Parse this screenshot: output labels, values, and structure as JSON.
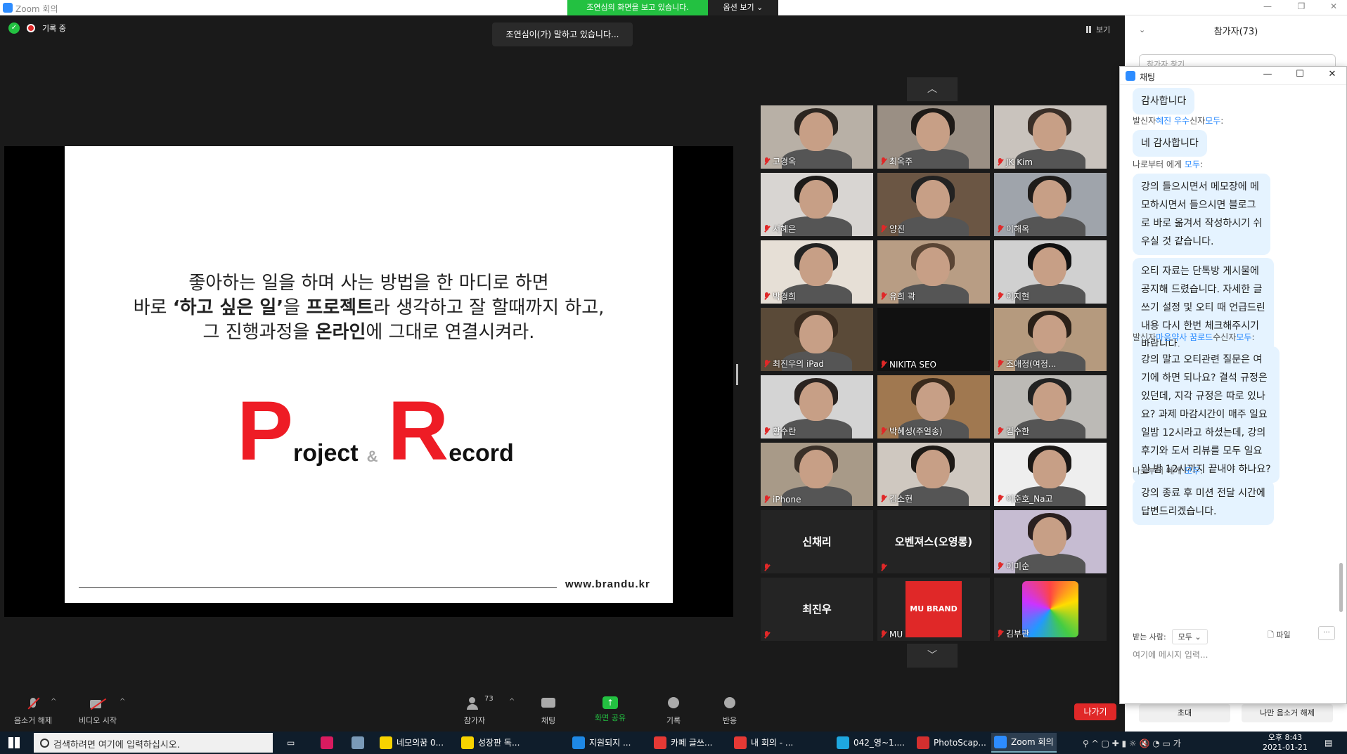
{
  "window": {
    "title": "Zoom 회의"
  },
  "banner": {
    "viewing": "조연심의 화면을 보고 있습니다.",
    "options": "옵션 보기 ⌄"
  },
  "status": {
    "recording": "기록 중",
    "speaking": "조연심이(가) 말하고 있습니다...",
    "view": "보기"
  },
  "slide": {
    "line1": "좋아하는 일을 하며 사는 방법을 한 마디로 하면",
    "line2_a": "바로 ",
    "line2_b": "‘하고 싶은 일’",
    "line2_c": "을 ",
    "line2_d": "프로젝트",
    "line2_e": "라 생각하고 잘 할때까지 하고,",
    "line3_a": "그 진행과정을 ",
    "line3_b": "온라인",
    "line3_c": "에 그대로 연결시켜라.",
    "logo_p": "P",
    "logo_project": "roject",
    "logo_amp": "&",
    "logo_r": "R",
    "logo_record": "ecord",
    "url": "www.brandu.kr"
  },
  "gallery": {
    "tiles": [
      {
        "name": "고경옥",
        "bg": "#b8b0a6",
        "hair": "#2b2520",
        "kind": "face"
      },
      {
        "name": "최옥주",
        "bg": "#9a8f84",
        "hair": "#1e1a17",
        "kind": "face"
      },
      {
        "name": "JK Kim",
        "bg": "#c9c3bd",
        "hair": "#3a2f28",
        "kind": "face"
      },
      {
        "name": "서혜은",
        "bg": "#d8d5d2",
        "hair": "#1c1a18",
        "kind": "face"
      },
      {
        "name": "양진",
        "bg": "#6b5644",
        "hair": "#222",
        "kind": "face"
      },
      {
        "name": "이해옥",
        "bg": "#9fa4ab",
        "hair": "#1f1c1a",
        "kind": "face"
      },
      {
        "name": "박경희",
        "bg": "#e6dfd6",
        "hair": "#222",
        "kind": "face"
      },
      {
        "name": "유희 곽",
        "bg": "#b89d84",
        "hair": "#5a4535",
        "kind": "face"
      },
      {
        "name": "이지현",
        "bg": "#d0d0d0",
        "hair": "#111",
        "kind": "face"
      },
      {
        "name": "최진우의 iPad",
        "bg": "#5a4a38",
        "hair": "#3a2c20",
        "kind": "face"
      },
      {
        "name": "NIKITA SEO",
        "bg": "#111111",
        "hair": "#111111",
        "kind": "dark"
      },
      {
        "name": "조애정(여정...",
        "bg": "#b59a7e",
        "hair": "#2a2018",
        "kind": "face"
      },
      {
        "name": "황수란",
        "bg": "#d4d4d4",
        "hair": "#2a2320",
        "kind": "face"
      },
      {
        "name": "박혜성(주얼송)",
        "bg": "#a07850",
        "hair": "#3a2a1c",
        "kind": "face"
      },
      {
        "name": "김수한",
        "bg": "#bcbab6",
        "hair": "#222",
        "kind": "face"
      },
      {
        "name": "iPhone",
        "bg": "#a89a88",
        "hair": "#3a3028",
        "kind": "face"
      },
      {
        "name": "김소현",
        "bg": "#cfc8c0",
        "hair": "#1e1a16",
        "kind": "face"
      },
      {
        "name": "이준호_Na고",
        "bg": "#eeeeee",
        "hair": "#1b1816",
        "kind": "face"
      },
      {
        "name": "신채리",
        "bg": "#242424",
        "hair": "",
        "kind": "text"
      },
      {
        "name": "오벤져스(오영롱)",
        "bg": "#242424",
        "hair": "",
        "kind": "text"
      },
      {
        "name": "이미순",
        "bg": "#c6bcd2",
        "hair": "#2a2020",
        "kind": "face"
      },
      {
        "name": "최진우",
        "bg": "#242424",
        "hair": "",
        "kind": "text"
      },
      {
        "name": "MU",
        "bg": "#242424",
        "hair": "",
        "kind": "logo",
        "logo_text": "MU BRAND"
      },
      {
        "name": "김부관",
        "bg": "#242424",
        "hair": "",
        "kind": "art"
      }
    ]
  },
  "toolbar": {
    "unmute": "음소거 해제",
    "start_video": "비디오 시작",
    "participants": "참가자",
    "participants_count": "73",
    "chat": "채팅",
    "share": "화면 공유",
    "record": "기록",
    "reactions": "반응",
    "leave": "나가기"
  },
  "participants_panel": {
    "title": "참가자(73)",
    "search_placeholder": "참가자 찾기",
    "invite": "초대",
    "unmute_me": "나만 음소거 해제"
  },
  "chat": {
    "title": "채팅",
    "messages": [
      {
        "sender": "",
        "text": "감사합니다"
      },
      {
        "sender_a": "발신자",
        "sender_b": "혜진 우수",
        "sender_c": "신자",
        "sender_d": "모두",
        "sender_e": ":",
        "text": "네 감사합니다"
      },
      {
        "sender_a": "나로부터 에게 ",
        "sender_d": "모두",
        "sender_e": ":",
        "text": "강의 들으시면서 메모장에 메\n모하시면서 들으시면 블로그\n로 바로 옮겨서 작성하시기 쉬\n우실 것 같습니다."
      },
      {
        "text": "오티 자료는 단톡방 게시물에\n공지해 드렸습니다. 자세한 글\n쓰기 설정 및 오티 때 언급드린\n내용 다시 한번 체크해주시기\n바랍니다."
      },
      {
        "sender_a": "발신자",
        "sender_b": "마음약사 꿈로드",
        "sender_c": "수신자",
        "sender_d": "모두",
        "sender_e": ":",
        "text": "강의 말고 오티관련 질문은 여\n기에 하면 되나요? 결석 규정은\n있던데, 지각 규정은 따로 있나\n요? 과제 마감시간이 매주 일요\n일밤 12시라고 하셨는데, 강의\n후기와 도서 리뷰를 모두 일요\n일 밤 12시까지 끝내야 하나요?"
      },
      {
        "sender_a": "나로부터 에게 ",
        "sender_d": "모두",
        "sender_e": ":",
        "text": "강의 종료 후 미션 전달 시간에\n답변드리겠습니다."
      }
    ],
    "to_label": "받는 사람:",
    "to_value": "모두 ⌄",
    "file": "파일",
    "input_placeholder": "여기에 메시지 입력..."
  },
  "taskbar": {
    "search_placeholder": "검색하려면 여기에 입력하십시오.",
    "tasks": [
      {
        "label": "네모의꿈 0...",
        "color": "#f7d300"
      },
      {
        "label": "성장판 독...",
        "color": "#f7d300"
      },
      {
        "label": "지원되지 ...",
        "color": "#1e88e5"
      },
      {
        "label": "카페 글쓰...",
        "color": "#e53935"
      },
      {
        "label": "내 회의 - ...",
        "color": "#e53935"
      },
      {
        "label": "042_영~1....",
        "color": "#1ea7e0"
      },
      {
        "label": "PhotoScap...",
        "color": "#d32f2f"
      },
      {
        "label": "Zoom 회의",
        "color": "#2d8cff"
      }
    ],
    "time": "오후 8:43",
    "date": "2021-01-21",
    "ime": "가"
  }
}
